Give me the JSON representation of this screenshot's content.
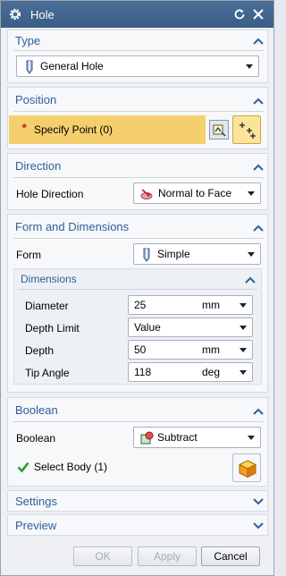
{
  "window": {
    "title": "Hole"
  },
  "colors": {
    "title_bar": "#3f6690",
    "section_title": "#2f5f98",
    "required_bg": "#f5cf6e",
    "required_star": "#c00000",
    "check_green": "#2e9c2e"
  },
  "type": {
    "title": "Type",
    "selected": "General Hole",
    "icon": "hole-icon"
  },
  "position": {
    "title": "Position",
    "required_marker": "*",
    "specify_point_label": "Specify Point (0)",
    "icons": [
      "sketch-section-icon",
      "point-dialog-icon"
    ]
  },
  "direction": {
    "title": "Direction",
    "label": "Hole Direction",
    "selected": "Normal to Face",
    "icon": "normal-to-face-icon"
  },
  "form_dimensions": {
    "title": "Form and Dimensions",
    "form_label": "Form",
    "form_selected": "Simple",
    "dimensions": {
      "title": "Dimensions",
      "rows": [
        {
          "label": "Diameter",
          "value": "25",
          "unit": "mm"
        },
        {
          "label": "Depth Limit",
          "value": "Value",
          "unit": ""
        },
        {
          "label": "Depth",
          "value": "50",
          "unit": "mm"
        },
        {
          "label": "Tip Angle",
          "value": "118",
          "unit": "deg"
        }
      ]
    }
  },
  "boolean": {
    "title": "Boolean",
    "label": "Boolean",
    "selected": "Subtract",
    "select_body_label": "Select Body (1)",
    "icon": "subtract-icon"
  },
  "settings": {
    "title": "Settings"
  },
  "preview": {
    "title": "Preview"
  },
  "footer": {
    "ok": "OK",
    "apply": "Apply",
    "cancel": "Cancel"
  }
}
